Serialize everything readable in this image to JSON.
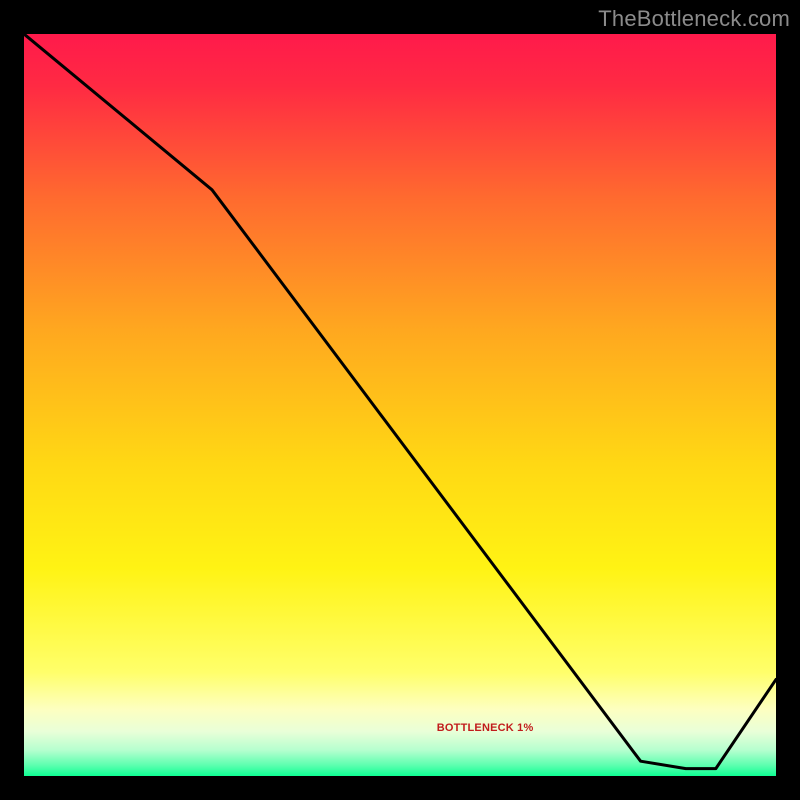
{
  "watermark": "TheBottleneck.com",
  "annotation": "BOTTLENECK 1%",
  "chart_data": {
    "type": "line",
    "title": "",
    "xlabel": "",
    "ylabel": "",
    "xlim": [
      0,
      100
    ],
    "ylim": [
      0,
      100
    ],
    "background_gradient_stops": [
      {
        "offset": 0.0,
        "color": "#ff1a4b"
      },
      {
        "offset": 0.07,
        "color": "#ff2a43"
      },
      {
        "offset": 0.22,
        "color": "#ff6a2f"
      },
      {
        "offset": 0.4,
        "color": "#ffa81f"
      },
      {
        "offset": 0.58,
        "color": "#ffd814"
      },
      {
        "offset": 0.72,
        "color": "#fff314"
      },
      {
        "offset": 0.86,
        "color": "#ffff6a"
      },
      {
        "offset": 0.91,
        "color": "#fdffc0"
      },
      {
        "offset": 0.94,
        "color": "#e9ffd8"
      },
      {
        "offset": 0.965,
        "color": "#b6ffcf"
      },
      {
        "offset": 0.985,
        "color": "#5fffb0"
      },
      {
        "offset": 1.0,
        "color": "#0fff94"
      }
    ],
    "series": [
      {
        "name": "bottleneck-curve",
        "x": [
          0,
          25,
          82,
          88,
          92,
          100
        ],
        "y": [
          100,
          79,
          2,
          1,
          1,
          13
        ]
      }
    ],
    "annotations": [
      {
        "text": "BOTTLENECK 1%",
        "x": 83,
        "y": 2,
        "color": "#c11c1c"
      }
    ]
  }
}
